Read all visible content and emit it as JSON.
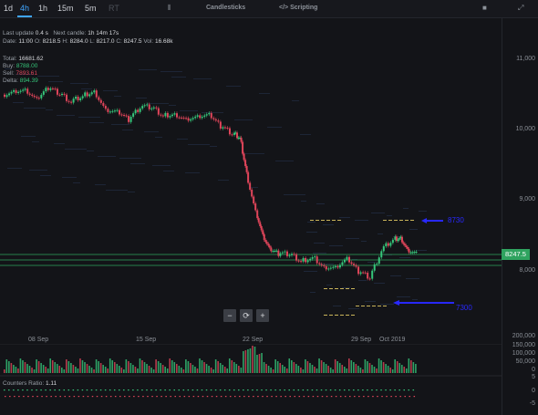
{
  "topbar": {
    "timeframes": [
      "1d",
      "4h",
      "1h",
      "15m",
      "5m",
      "RT"
    ],
    "active": "4h",
    "center_tool": "Candlesticks",
    "scripting": "Scripting"
  },
  "info": {
    "last_update_label": "Last update",
    "last_update_value": "0.4 s",
    "next_candle_label": "Next candle:",
    "next_candle_value": "1h 14m 17s",
    "date_label": "Date:",
    "date_value": "11:00",
    "o_label": "O:",
    "o_value": "8218.5",
    "h_label": "H:",
    "h_value": "8284.0",
    "l_label": "L:",
    "l_value": "8217.0",
    "c_label": "C:",
    "c_value": "8247.5",
    "vol_label": "Vol:",
    "vol_value": "16.68k",
    "total_label": "Total:",
    "total_value": "16681.62",
    "buy_label": "Buy:",
    "buy_value": "8788.00",
    "sell_label": "Sell:",
    "sell_value": "7893.61",
    "delta_label": "Delta:",
    "delta_value": "894.39",
    "counters_label": "Counters Ratio:",
    "counters_value": "1.11"
  },
  "y_axis": [
    "11,000",
    "10,000",
    "9,000",
    "8,000"
  ],
  "price_tag": "8247.5",
  "volume_axis": [
    "200,000",
    "150,000",
    "100,000",
    "50,000",
    "0"
  ],
  "counter_axis": [
    "5",
    "0",
    "-5"
  ],
  "x_axis": [
    "08 Sep",
    "15 Sep",
    "22 Sep",
    "29 Sep",
    "Oct 2019"
  ],
  "annotations": {
    "upper": "8730",
    "lower": "7300"
  },
  "zoom": {
    "minus": "−",
    "reset": "⟳",
    "plus": "+"
  },
  "colors": {
    "up": "#36c57a",
    "down": "#e0455a",
    "accent": "#3fa6ff",
    "annotation": "#2828ff"
  },
  "chart_data": {
    "type": "candlestick",
    "x_range": [
      "01 Sep",
      "Oct 2019"
    ],
    "y_range": [
      7300,
      11400
    ],
    "close_path": [
      [
        0,
        10500
      ],
      [
        5,
        10550
      ],
      [
        10,
        10560
      ],
      [
        15,
        10420
      ],
      [
        20,
        10600
      ],
      [
        25,
        10520
      ],
      [
        30,
        10400
      ],
      [
        35,
        10480
      ],
      [
        40,
        10550
      ],
      [
        45,
        10280
      ],
      [
        50,
        10250
      ],
      [
        55,
        10150
      ],
      [
        60,
        10330
      ],
      [
        65,
        10320
      ],
      [
        70,
        10200
      ],
      [
        75,
        10230
      ],
      [
        80,
        10150
      ],
      [
        85,
        10180
      ],
      [
        90,
        10200
      ],
      [
        95,
        10050
      ],
      [
        100,
        9950
      ],
      [
        103,
        9900
      ],
      [
        106,
        9400
      ],
      [
        110,
        8850
      ],
      [
        113,
        8500
      ],
      [
        116,
        8300
      ],
      [
        120,
        8250
      ],
      [
        125,
        8250
      ],
      [
        130,
        8150
      ],
      [
        135,
        8200
      ],
      [
        140,
        8060
      ],
      [
        145,
        8050
      ],
      [
        150,
        8170
      ],
      [
        155,
        8000
      ],
      [
        160,
        7920
      ],
      [
        165,
        8300
      ],
      [
        170,
        8450
      ],
      [
        173,
        8480
      ],
      [
        176,
        8300
      ],
      [
        180,
        8247.5
      ]
    ]
  }
}
